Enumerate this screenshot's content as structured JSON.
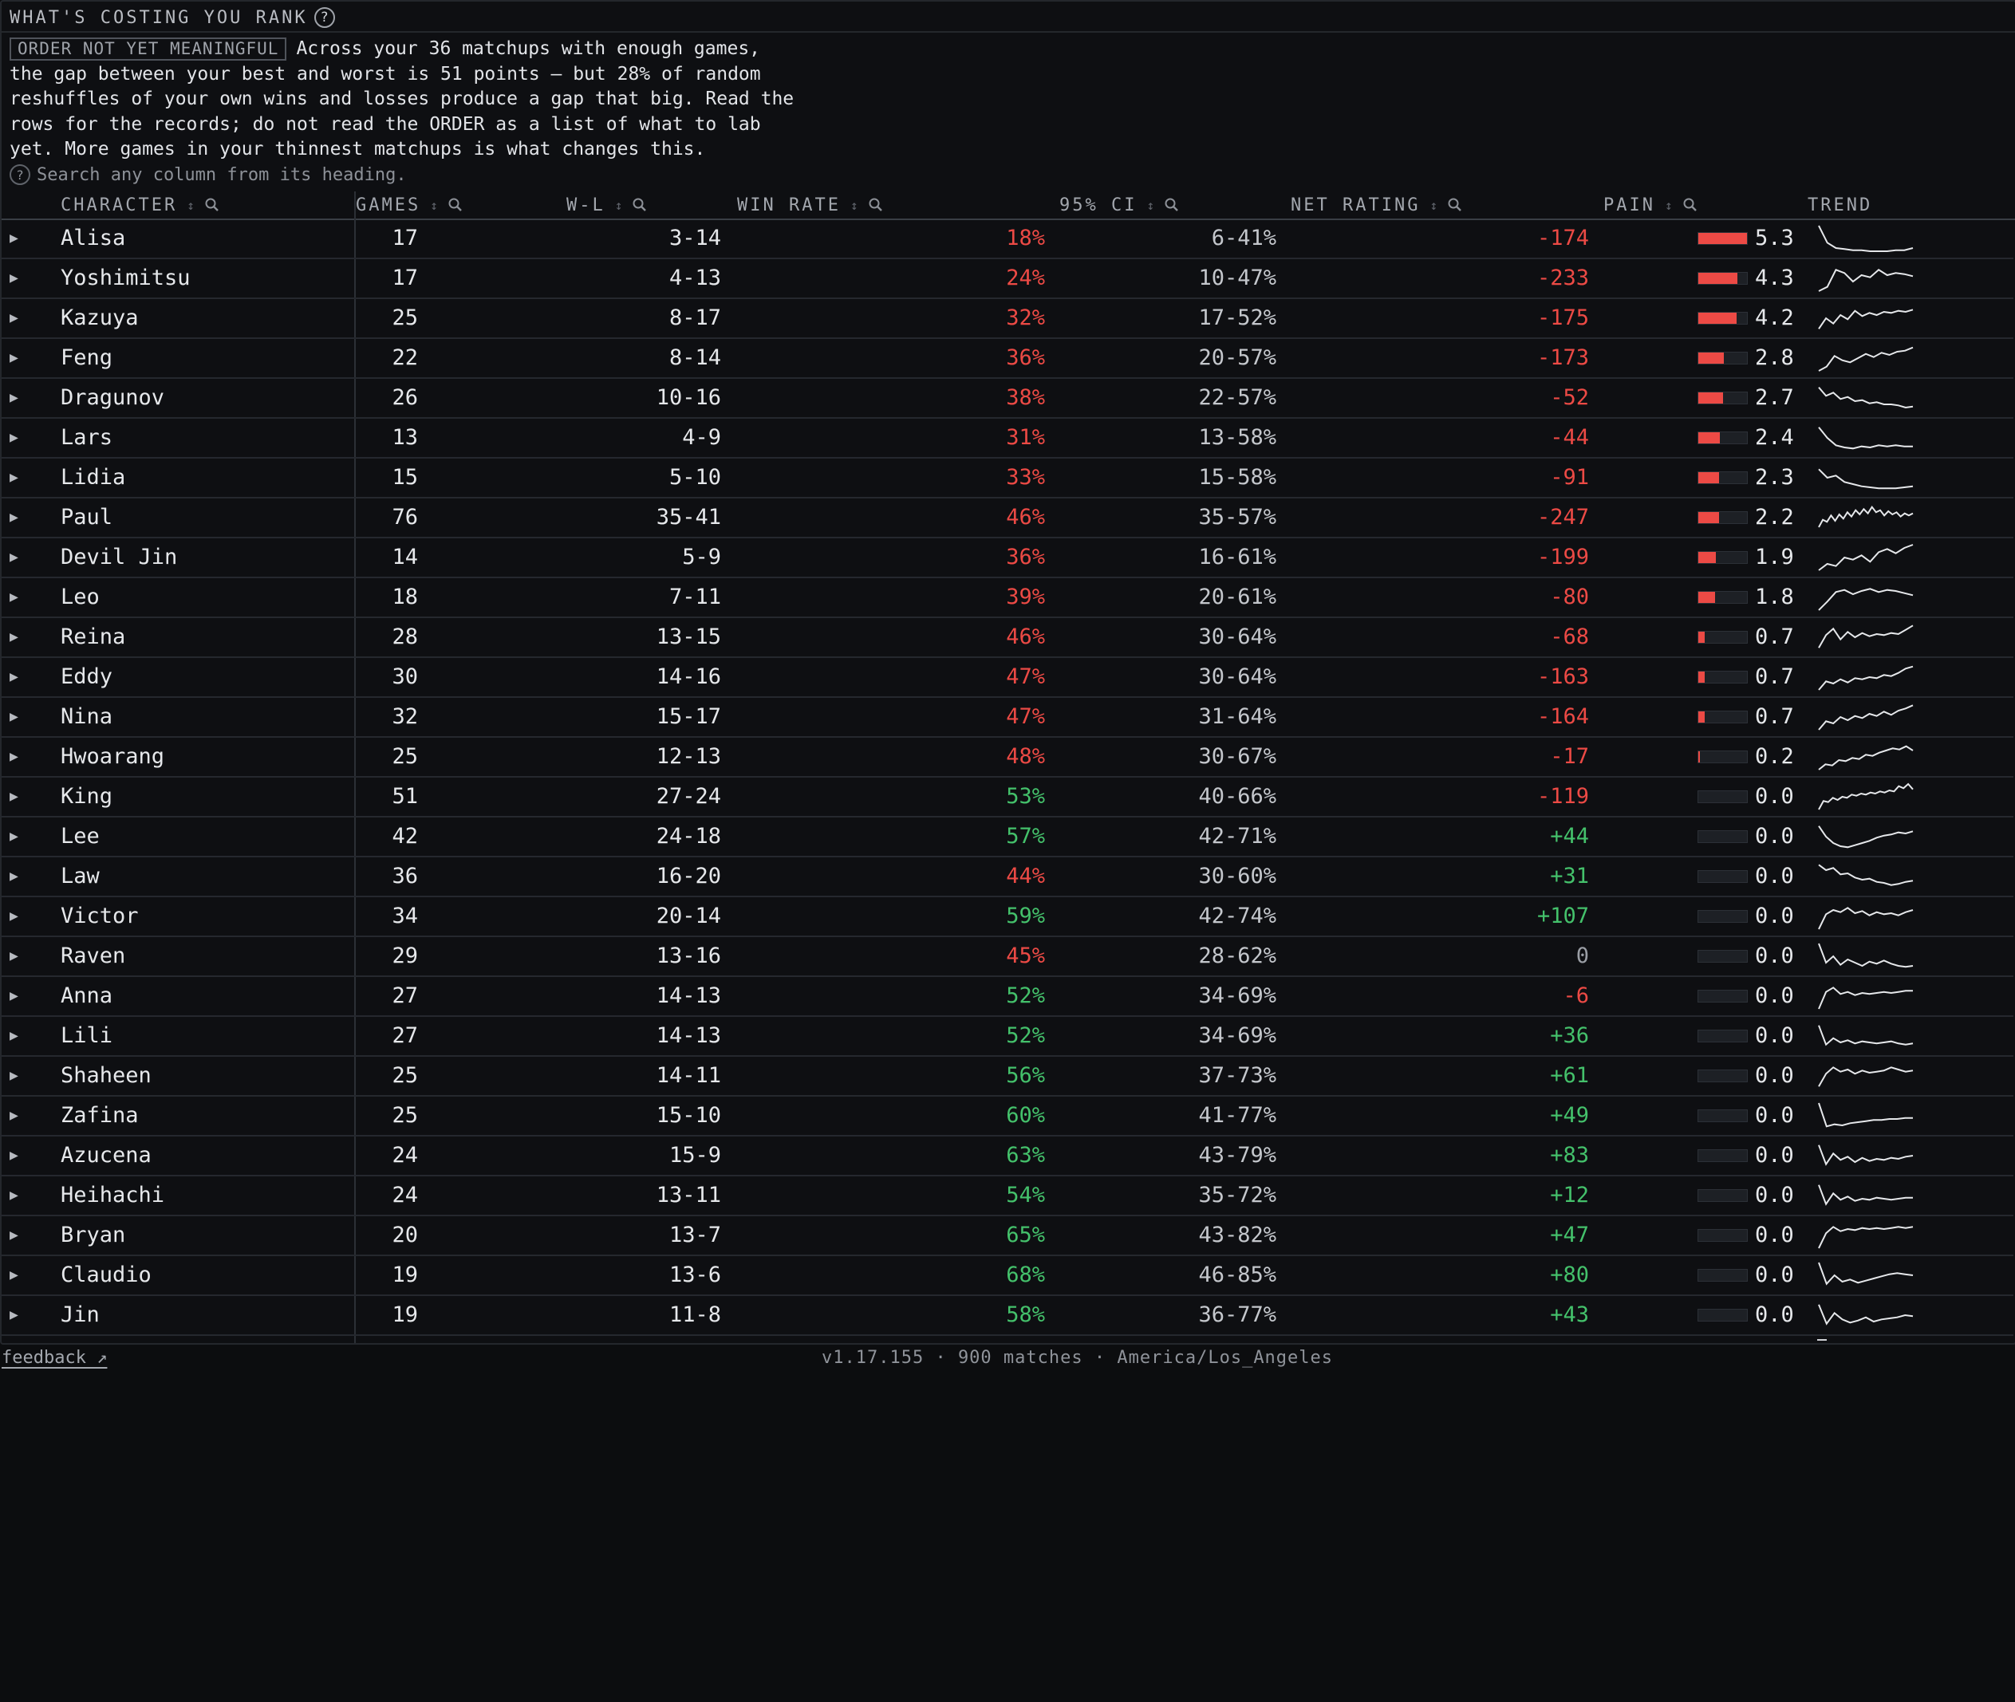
{
  "header": {
    "title": "WHAT'S COSTING YOU RANK",
    "help_glyph": "?"
  },
  "notice": {
    "badge": "ORDER NOT YET MEANINGFUL",
    "lines": [
      "Across your 36 matchups with enough games,",
      "the gap between your best and worst is 51 points — but 28% of random",
      "reshuffles of your own wins and losses produce a gap that big. Read the",
      "rows for the records; do not read the ORDER as a list of what to lab",
      "yet. More games in your thinnest matchups is what changes this."
    ]
  },
  "search_hint": {
    "glyph": "?",
    "text": "Search any column from its heading."
  },
  "columns": {
    "character": "CHARACTER",
    "games": "GAMES",
    "wl": "W-L",
    "win_rate": "WIN RATE",
    "ci": "95% CI",
    "net_rating": "NET RATING",
    "pain": "PAIN",
    "trend": "TREND",
    "sort_glyph": "↕"
  },
  "colors": {
    "negative": "#ec4a45",
    "positive": "#44c16b",
    "pain_bar": "#ec4a45",
    "spark_line": "#e6e8eb"
  },
  "rows": [
    {
      "name": "Alisa",
      "games": "17",
      "wl": "3-14",
      "win_rate": "18%",
      "ci": "6-41%",
      "net": "-174",
      "pain": "5.3",
      "pain_level": 1.0,
      "trend": [
        24,
        8,
        3,
        2,
        1,
        1,
        0,
        0,
        0,
        1,
        1,
        3
      ]
    },
    {
      "name": "Yoshimitsu",
      "games": "17",
      "wl": "4-13",
      "win_rate": "24%",
      "ci": "10-47%",
      "net": "-233",
      "pain": "4.3",
      "pain_level": 0.81,
      "trend": [
        0,
        4,
        20,
        17,
        9,
        15,
        13,
        20,
        15,
        17,
        16,
        14
      ]
    },
    {
      "name": "Kazuya",
      "games": "25",
      "wl": "8-17",
      "win_rate": "32%",
      "ci": "17-52%",
      "net": "-175",
      "pain": "4.2",
      "pain_level": 0.79,
      "trend": [
        2,
        12,
        7,
        15,
        11,
        19,
        14,
        17,
        15,
        18,
        17,
        19,
        18,
        20
      ]
    },
    {
      "name": "Feng",
      "games": "22",
      "wl": "8-14",
      "win_rate": "36%",
      "ci": "20-57%",
      "net": "-173",
      "pain": "2.8",
      "pain_level": 0.53,
      "trend": [
        0,
        4,
        14,
        10,
        8,
        12,
        16,
        13,
        17,
        15,
        18,
        19,
        22
      ]
    },
    {
      "name": "Dragunov",
      "games": "26",
      "wl": "10-16",
      "win_rate": "38%",
      "ci": "22-57%",
      "net": "-52",
      "pain": "2.7",
      "pain_level": 0.51,
      "trend": [
        22,
        14,
        17,
        11,
        13,
        9,
        10,
        7,
        8,
        6,
        6,
        5,
        3,
        4
      ]
    },
    {
      "name": "Lars",
      "games": "13",
      "wl": "4-9",
      "win_rate": "31%",
      "ci": "13-58%",
      "net": "-44",
      "pain": "2.4",
      "pain_level": 0.45,
      "trend": [
        22,
        12,
        5,
        3,
        2,
        4,
        3,
        5,
        4,
        5,
        4,
        4
      ]
    },
    {
      "name": "Lidia",
      "games": "15",
      "wl": "5-10",
      "win_rate": "33%",
      "ci": "15-58%",
      "net": "-91",
      "pain": "2.3",
      "pain_level": 0.43,
      "trend": [
        20,
        12,
        14,
        8,
        6,
        4,
        3,
        2,
        2,
        2,
        3,
        4
      ]
    },
    {
      "name": "Paul",
      "games": "76",
      "wl": "35-41",
      "win_rate": "46%",
      "ci": "35-57%",
      "net": "-247",
      "pain": "2.2",
      "pain_level": 0.42,
      "trend": [
        3,
        10,
        8,
        14,
        9,
        15,
        11,
        17,
        13,
        19,
        15,
        20,
        16,
        22,
        17,
        19,
        14,
        18,
        15,
        17,
        13,
        16,
        14,
        16
      ]
    },
    {
      "name": "Devil Jin",
      "games": "14",
      "wl": "5-9",
      "win_rate": "36%",
      "ci": "16-61%",
      "net": "-199",
      "pain": "1.9",
      "pain_level": 0.36,
      "trend": [
        0,
        6,
        4,
        12,
        10,
        14,
        8,
        17,
        20,
        16,
        21,
        24
      ]
    },
    {
      "name": "Leo",
      "games": "18",
      "wl": "7-11",
      "win_rate": "39%",
      "ci": "20-61%",
      "net": "-80",
      "pain": "1.8",
      "pain_level": 0.34,
      "trend": [
        0,
        8,
        17,
        19,
        15,
        18,
        20,
        17,
        19,
        18,
        16,
        14
      ]
    },
    {
      "name": "Reina",
      "games": "28",
      "wl": "13-15",
      "win_rate": "46%",
      "ci": "30-64%",
      "net": "-68",
      "pain": "0.7",
      "pain_level": 0.13,
      "trend": [
        2,
        14,
        20,
        10,
        17,
        12,
        16,
        13,
        15,
        14,
        16,
        15,
        19,
        23
      ]
    },
    {
      "name": "Eddy",
      "games": "30",
      "wl": "14-16",
      "win_rate": "47%",
      "ci": "30-64%",
      "net": "-163",
      "pain": "0.7",
      "pain_level": 0.13,
      "trend": [
        0,
        8,
        6,
        10,
        7,
        11,
        10,
        12,
        11,
        14,
        13,
        16,
        20,
        22
      ]
    },
    {
      "name": "Nina",
      "games": "32",
      "wl": "15-17",
      "win_rate": "47%",
      "ci": "31-64%",
      "net": "-164",
      "pain": "0.7",
      "pain_level": 0.13,
      "trend": [
        0,
        8,
        6,
        12,
        9,
        13,
        11,
        15,
        13,
        17,
        14,
        18,
        20,
        23
      ]
    },
    {
      "name": "Hwoarang",
      "games": "25",
      "wl": "12-13",
      "win_rate": "48%",
      "ci": "30-67%",
      "net": "-17",
      "pain": "0.2",
      "pain_level": 0.04,
      "trend": [
        0,
        5,
        4,
        9,
        8,
        11,
        10,
        14,
        13,
        16,
        18,
        20,
        19,
        22,
        18
      ]
    },
    {
      "name": "King",
      "games": "51",
      "wl": "27-24",
      "win_rate": "53%",
      "ci": "40-66%",
      "net": "-119",
      "pain": "0.0",
      "pain_level": 0,
      "trend": [
        0,
        8,
        7,
        11,
        9,
        12,
        11,
        14,
        13,
        15,
        14,
        16,
        15,
        17,
        16,
        18,
        17,
        22,
        20,
        24,
        19
      ]
    },
    {
      "name": "Lee",
      "games": "42",
      "wl": "24-18",
      "win_rate": "57%",
      "ci": "42-71%",
      "net": "+44",
      "pain": "0.0",
      "pain_level": 0,
      "trend": [
        22,
        12,
        6,
        3,
        2,
        4,
        6,
        8,
        11,
        13,
        14,
        16,
        15,
        17
      ]
    },
    {
      "name": "Law",
      "games": "36",
      "wl": "16-20",
      "win_rate": "44%",
      "ci": "30-60%",
      "net": "+31",
      "pain": "0.0",
      "pain_level": 0,
      "trend": [
        23,
        18,
        20,
        14,
        15,
        11,
        9,
        10,
        7,
        6,
        4,
        5,
        7,
        8
      ]
    },
    {
      "name": "Victor",
      "games": "34",
      "wl": "20-14",
      "win_rate": "59%",
      "ci": "42-74%",
      "net": "+107",
      "pain": "0.0",
      "pain_level": 0,
      "trend": [
        0,
        14,
        18,
        16,
        20,
        15,
        17,
        13,
        16,
        14,
        15,
        13,
        16,
        18
      ]
    },
    {
      "name": "Raven",
      "games": "29",
      "wl": "13-16",
      "win_rate": "45%",
      "ci": "28-62%",
      "net": "0",
      "pain": "0.0",
      "pain_level": 0,
      "trend": [
        24,
        6,
        12,
        4,
        9,
        6,
        3,
        7,
        5,
        8,
        5,
        3,
        2,
        3
      ]
    },
    {
      "name": "Anna",
      "games": "27",
      "wl": "14-13",
      "win_rate": "52%",
      "ci": "34-69%",
      "net": "-6",
      "pain": "0.0",
      "pain_level": 0,
      "trend": [
        0,
        16,
        20,
        14,
        16,
        13,
        15,
        14,
        15,
        16,
        15,
        16,
        17,
        17
      ]
    },
    {
      "name": "Lili",
      "games": "27",
      "wl": "14-13",
      "win_rate": "52%",
      "ci": "34-69%",
      "net": "+36",
      "pain": "0.0",
      "pain_level": 0,
      "trend": [
        22,
        4,
        10,
        6,
        8,
        5,
        7,
        6,
        5,
        6,
        7,
        5,
        4,
        5
      ]
    },
    {
      "name": "Shaheen",
      "games": "25",
      "wl": "14-11",
      "win_rate": "56%",
      "ci": "37-73%",
      "net": "+61",
      "pain": "0.0",
      "pain_level": 0,
      "trend": [
        2,
        14,
        20,
        16,
        18,
        14,
        17,
        15,
        16,
        17,
        20,
        18,
        16,
        17
      ]
    },
    {
      "name": "Zafina",
      "games": "25",
      "wl": "15-10",
      "win_rate": "60%",
      "ci": "41-77%",
      "net": "+49",
      "pain": "0.0",
      "pain_level": 0,
      "trend": [
        24,
        2,
        4,
        3,
        5,
        6,
        7,
        8,
        8,
        9,
        9,
        10,
        10
      ]
    },
    {
      "name": "Azucena",
      "games": "24",
      "wl": "15-9",
      "win_rate": "63%",
      "ci": "43-79%",
      "net": "+83",
      "pain": "0.0",
      "pain_level": 0,
      "trend": [
        22,
        4,
        14,
        8,
        11,
        6,
        10,
        7,
        9,
        8,
        10,
        9,
        11,
        12
      ]
    },
    {
      "name": "Heihachi",
      "games": "24",
      "wl": "13-11",
      "win_rate": "54%",
      "ci": "35-72%",
      "net": "+12",
      "pain": "0.0",
      "pain_level": 0,
      "trend": [
        22,
        4,
        14,
        8,
        11,
        7,
        9,
        8,
        10,
        9,
        8,
        9,
        10,
        10
      ]
    },
    {
      "name": "Bryan",
      "games": "20",
      "wl": "13-7",
      "win_rate": "65%",
      "ci": "43-82%",
      "net": "+47",
      "pain": "0.0",
      "pain_level": 0,
      "trend": [
        0,
        14,
        20,
        16,
        18,
        17,
        19,
        18,
        19,
        18,
        19,
        20,
        19,
        20
      ]
    },
    {
      "name": "Claudio",
      "games": "19",
      "wl": "13-6",
      "win_rate": "68%",
      "ci": "46-85%",
      "net": "+80",
      "pain": "0.0",
      "pain_level": 0,
      "trend": [
        24,
        4,
        12,
        6,
        8,
        5,
        7,
        9,
        11,
        13,
        14,
        13,
        12
      ]
    },
    {
      "name": "Jin",
      "games": "19",
      "wl": "11-8",
      "win_rate": "58%",
      "ci": "36-77%",
      "net": "+43",
      "pain": "0.0",
      "pain_level": 0,
      "trend": [
        22,
        4,
        14,
        8,
        5,
        7,
        10,
        6,
        8,
        9,
        10,
        12,
        11
      ]
    }
  ],
  "footer": {
    "feedback": "feedback ↗",
    "info": "v1.17.155 · 900 matches · America/Los_Angeles"
  }
}
